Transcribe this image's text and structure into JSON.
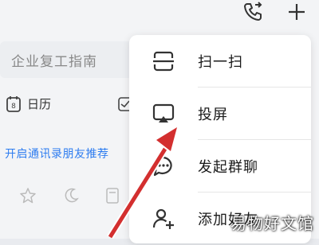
{
  "toolbar": {
    "phone_icon": "phone-icon",
    "plus_icon": "plus-icon"
  },
  "search": {
    "placeholder": "企业复工指南"
  },
  "quick_actions": {
    "calendar_label": "日历"
  },
  "promo": {
    "text": "开启通讯录朋友推荐",
    "close": "×"
  },
  "menu": {
    "items": [
      {
        "label": "扫一扫",
        "icon": "scan-icon"
      },
      {
        "label": "投屏",
        "icon": "screen-cast-icon"
      },
      {
        "label": "发起群聊",
        "icon": "group-chat-icon"
      },
      {
        "label": "添加好友",
        "icon": "add-friend-icon"
      }
    ]
  },
  "watermark": "易物好文馆",
  "colors": {
    "link": "#2d7cf0",
    "arrow": "#d32f2f",
    "menu_bg": "#ffffff",
    "bg": "#f3f4f6"
  }
}
